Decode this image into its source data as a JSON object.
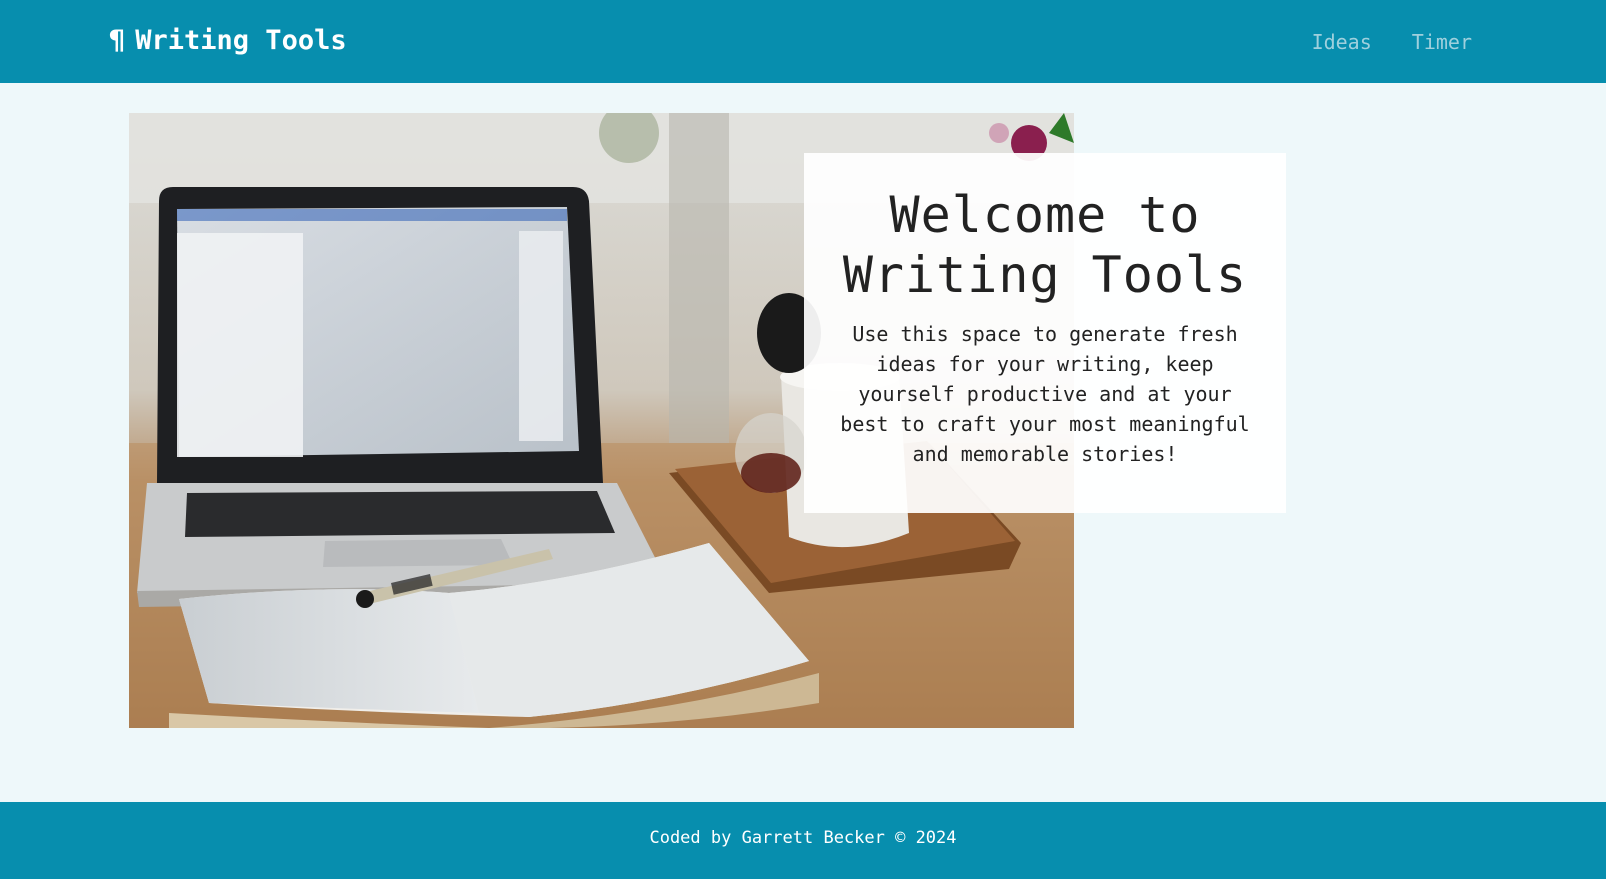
{
  "navbar": {
    "brand_icon": "¶",
    "brand_label": "Writing Tools",
    "links": [
      {
        "label": "Ideas"
      },
      {
        "label": "Timer"
      }
    ]
  },
  "hero": {
    "image": "laptop-notebook-pen-desk-photo"
  },
  "welcome": {
    "title": "Welcome to Writing Tools",
    "text": "Use this space to generate fresh ideas for your writing, keep yourself productive and at your best to craft your most meaningful and memorable stories!"
  },
  "footer": {
    "text": "Coded by Garrett Becker © 2024"
  },
  "colors": {
    "primary": "#078eae",
    "background": "#eef8fa",
    "nav_link": "#9fd0dd"
  }
}
